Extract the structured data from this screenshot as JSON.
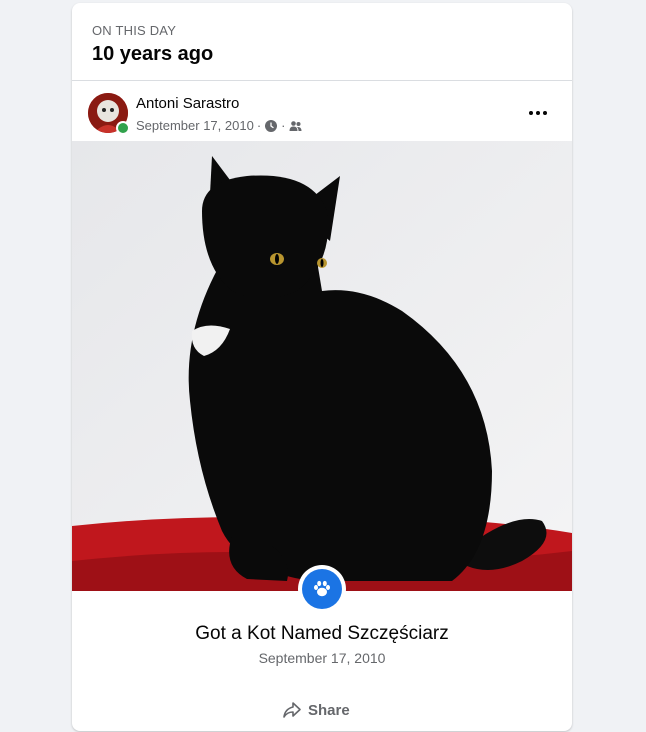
{
  "memory": {
    "eyebrow": "ON THIS DAY",
    "headline": "10 years ago"
  },
  "post": {
    "author": "Antoni Sarastro",
    "date": "September 17, 2010",
    "separator": "·",
    "more_icon": "more-horizontal-icon",
    "clock_icon": "clock-icon",
    "audience_icon": "friends-icon"
  },
  "photo": {
    "subject_icon": "paw-icon"
  },
  "life_event": {
    "title": "Got a Kot Named Szczęściarz",
    "date": "September 17, 2010"
  },
  "actions": {
    "share_label": "Share"
  },
  "colors": {
    "accent": "#1b74e4",
    "online": "#31a24c",
    "secondary_text": "#65676b"
  }
}
